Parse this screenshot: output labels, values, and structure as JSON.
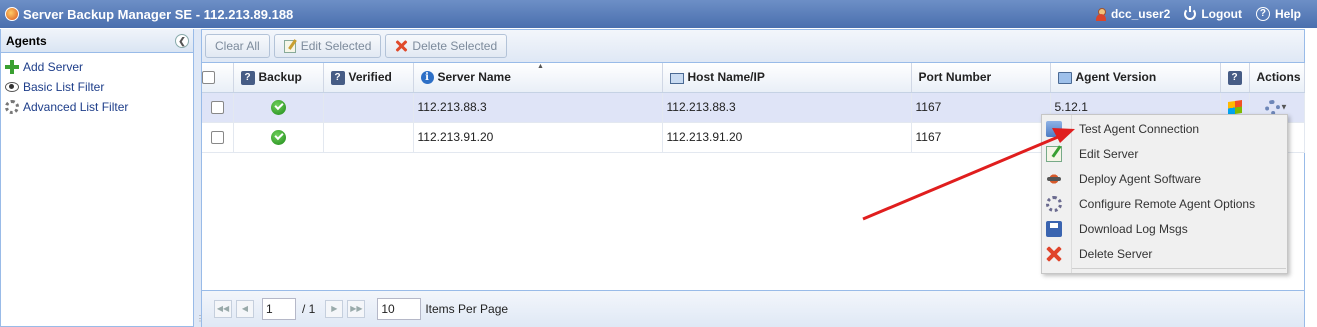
{
  "app": {
    "title": "Server Backup Manager SE - 112.213.89.188",
    "user": "dcc_user2",
    "logout": "Logout",
    "help": "Help"
  },
  "sidebar": {
    "title": "Agents",
    "collapse_icon": "chevron-left-icon",
    "items": [
      {
        "label": "Add Server",
        "icon": "add-icon"
      },
      {
        "label": "Basic List Filter",
        "icon": "eye-icon"
      },
      {
        "label": "Advanced List Filter",
        "icon": "gears-icon"
      }
    ]
  },
  "toolbar": {
    "clear_all": "Clear All",
    "edit_selected": "Edit Selected",
    "delete_selected": "Delete Selected"
  },
  "grid": {
    "columns": {
      "backup": "Backup",
      "verified": "Verified",
      "server_name": "Server Name",
      "host": "Host Name/IP",
      "port": "Port Number",
      "agent_version": "Agent Version",
      "os": "",
      "actions": "Actions"
    },
    "rows": [
      {
        "server_name": "112.213.88.3",
        "host": "112.213.88.3",
        "port": "1167",
        "agent_version": "5.12.1",
        "backup_status": "ok",
        "selected": true
      },
      {
        "server_name": "112.213.91.20",
        "host": "112.213.91.20",
        "port": "1167",
        "agent_version": "",
        "backup_status": "ok",
        "selected": false
      }
    ]
  },
  "paging": {
    "page": "1",
    "of_label": "/ 1",
    "page_size": "10",
    "items_per_page_label": "Items Per Page"
  },
  "context_menu": {
    "items": [
      {
        "label": "Test Agent Connection",
        "icon": "test-connection-icon"
      },
      {
        "label": "Edit Server",
        "icon": "edit-icon"
      },
      {
        "label": "Deploy Agent Software",
        "icon": "deploy-icon"
      },
      {
        "label": "Configure Remote Agent Options",
        "icon": "configure-icon"
      },
      {
        "label": "Download Log Msgs",
        "icon": "save-icon"
      },
      {
        "label": "Delete Server",
        "icon": "delete-icon"
      }
    ]
  },
  "colors": {
    "titlebar": "#4a6fae",
    "selected_row": "#dfe4f7",
    "annotation_arrow": "#e01e1e"
  }
}
